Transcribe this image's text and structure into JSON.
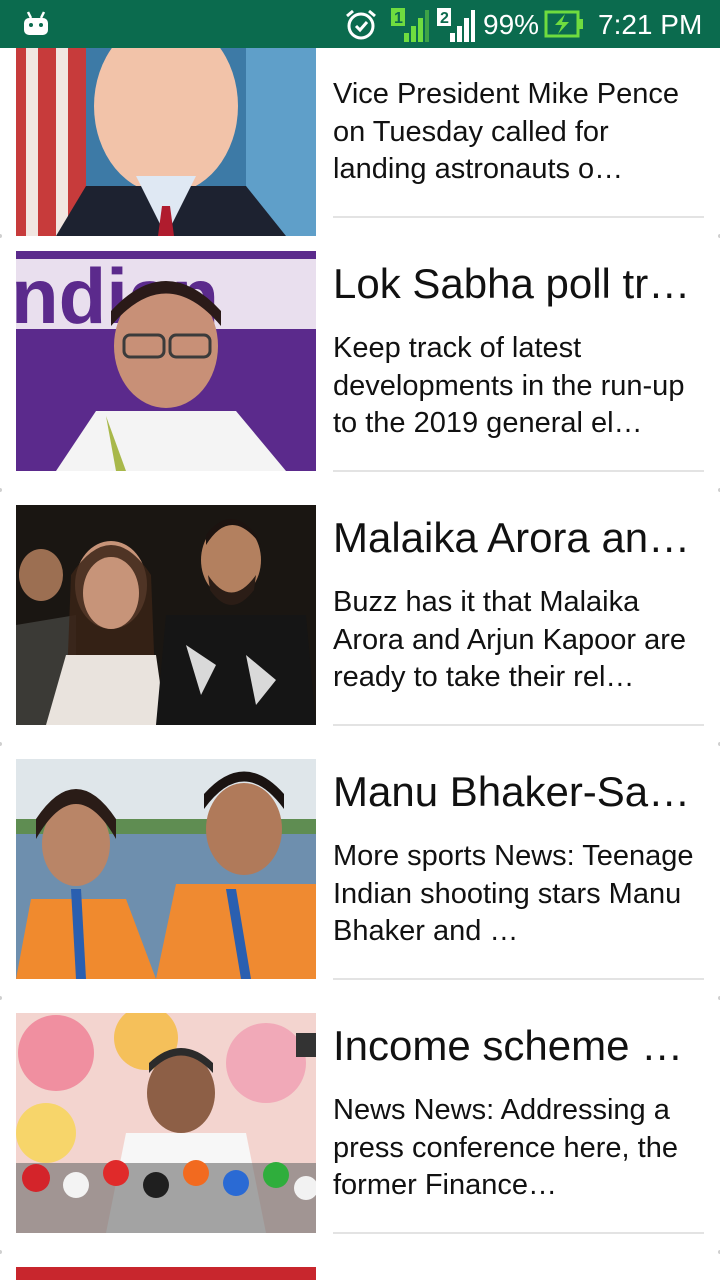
{
  "status_bar": {
    "battery_percent": "99%",
    "time": "7:21 PM",
    "sim1_label": "1",
    "sim2_label": "2",
    "icons": [
      "android-icon",
      "alarm-icon",
      "signal-sim1-icon",
      "signal-sim2-icon",
      "battery-charging-icon"
    ],
    "background_color": "#0b6b4e"
  },
  "articles": [
    {
      "headline": "",
      "summary": "Vice President Mike Pence on Tuesday called for landing astronauts o…",
      "image": "mike-pence-photo"
    },
    {
      "headline": "Lok Sabha poll tr…",
      "summary": "Keep track of latest developments in the run-up to the 2019 general el…",
      "image": "mamata-banerjee-photo"
    },
    {
      "headline": "Malaika Arora an…",
      "summary": "Buzz has it that Malaika Arora and Arjun Kapoor are ready to take their rel…",
      "image": "malaika-arjun-photo"
    },
    {
      "headline": "Manu Bhaker-Sau…",
      "summary": "More sports News: Teenage Indian shooting stars Manu Bhaker and …",
      "image": "manu-bhaker-saurabh-photo"
    },
    {
      "headline": "Income scheme …",
      "summary": "News News: Addressing a press conference here, the former Finance…",
      "image": "chidambaram-press-photo"
    }
  ]
}
